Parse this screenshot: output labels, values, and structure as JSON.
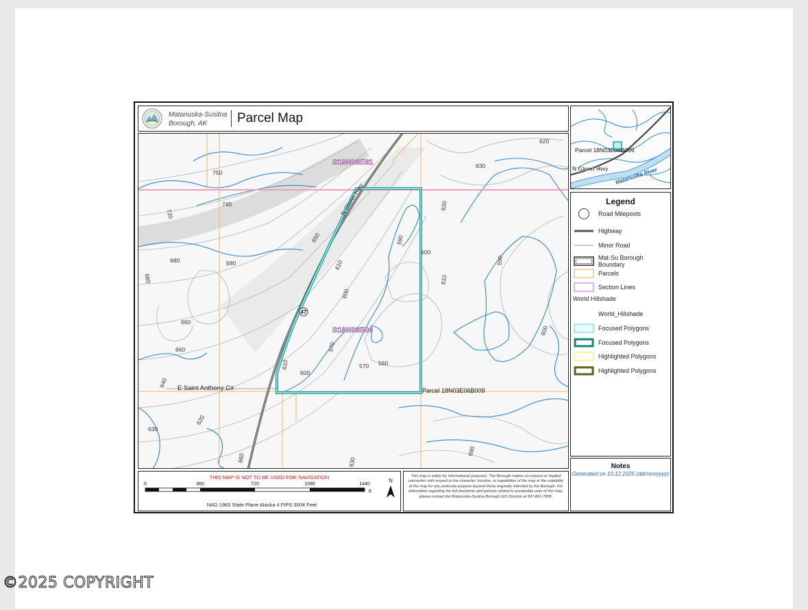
{
  "header": {
    "org_line1": "Matanuska-Susitna",
    "org_line2": "Borough, AK",
    "title": "Parcel Map"
  },
  "map": {
    "section_north": "S19N03E31",
    "section_parcel": "S18N03E06",
    "road_name": "E Saint Anthony Cir",
    "highway_label": "N Glenn Hwy",
    "parcel_label": "Parcel 18N03E06B009",
    "milepost": "47",
    "contour_labels": [
      "750",
      "740",
      "720",
      "680",
      "690",
      "650",
      "610",
      "600",
      "570",
      "590",
      "560",
      "570",
      "600",
      "620",
      "630",
      "600",
      "610",
      "590",
      "620",
      "600",
      "660",
      "680",
      "660",
      "610",
      "630",
      "620",
      "640",
      "690",
      "660",
      "630"
    ]
  },
  "inset": {
    "parcel_label": "Parcel 18N03E06B009",
    "highway_label": "N Glenn Hwy",
    "river_label": "Matanuska River"
  },
  "legend": {
    "title": "Legend",
    "items": [
      {
        "label": "Road Mileposts",
        "symbol": "circle"
      },
      {
        "label": "Highway",
        "symbol": "thick-line"
      },
      {
        "label": "Minor Road",
        "symbol": "thin-line"
      },
      {
        "label": "Mat-Su Borough Boundary",
        "symbol": "double-box"
      },
      {
        "label": "Parcels",
        "symbol": "orange-box"
      },
      {
        "label": "Section Lines",
        "symbol": "violet-box"
      },
      {
        "label": "World Hillshade",
        "symbol": "none-group"
      },
      {
        "label": "World_Hillshade",
        "symbol": "none"
      },
      {
        "label": "Focused Polygons",
        "symbol": "cyan-box"
      },
      {
        "label": "Focused Polygons",
        "symbol": "teal-box"
      },
      {
        "label": "Highlighted Polygons",
        "symbol": "yellow-box"
      },
      {
        "label": "Highlighted Polygons",
        "symbol": "olive-box"
      }
    ]
  },
  "notes": {
    "title": "Notes",
    "text": "Generated on 10.12.2025 (dd/mm/yyyy)"
  },
  "scale": {
    "warning": "THIS MAP IS NOT TO BE USED FOR NAVIGATION",
    "ticks": [
      "0",
      "360",
      "720",
      "1080",
      "1440"
    ],
    "unit": "ft",
    "north": "N",
    "projection": "NAD 1983 State Plane Alaska 4 FIPS 5004 Feet"
  },
  "disclaimer": "This map is solely for informational purposes. The Borough makes no express or implied warranties with respect to the character, function, or capabilities of the map or the suitability of the map for any particular purpose beyond those originally intended by the Borough. For information regarding the full disclaimer and policies related to acceptable uses of this map, please contact the Matanuska-Susitna Borough GIS Division at 907-861-7858.",
  "watermark": "©2025 COPYRIGHT",
  "colors": {
    "contour_blue": "#2f86c6",
    "contour_gray": "#a8a8a8",
    "parcel_teal": "#1e9c9a",
    "parcel_line": "#f0b46a",
    "section_line": "#ee9fb8",
    "section_label": "#7a2f86"
  }
}
